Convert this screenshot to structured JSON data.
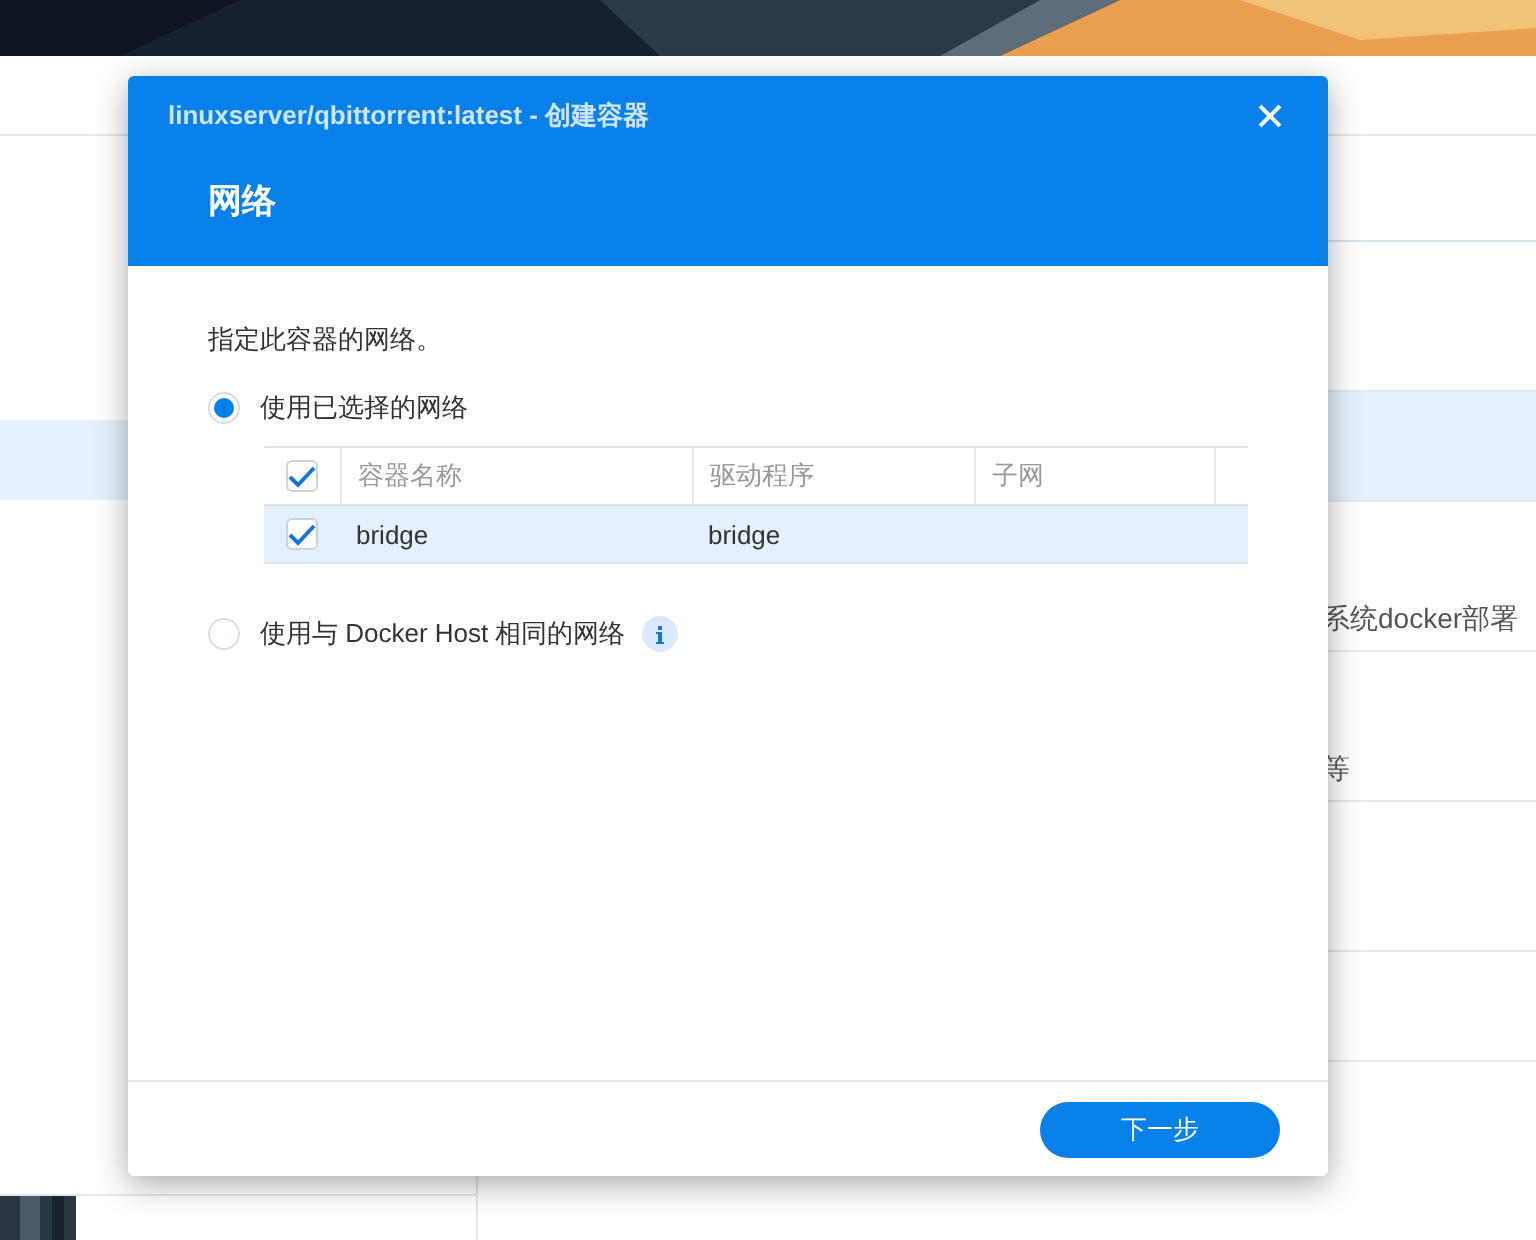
{
  "background": {
    "row_texts": [
      "系统docker部署",
      "等"
    ]
  },
  "dialog": {
    "title": "linuxserver/qbittorrent:latest - 创建容器",
    "heading": "网络",
    "description": "指定此容器的网络。",
    "options": [
      {
        "label": "使用已选择的网络",
        "selected": true,
        "info": false
      },
      {
        "label": "使用与 Docker Host 相同的网络",
        "selected": false,
        "info": true
      }
    ],
    "table": {
      "all_checked": true,
      "columns": [
        "容器名称",
        "驱动程序",
        "子网"
      ],
      "rows": [
        {
          "checked": true,
          "selected": true,
          "cells": [
            "bridge",
            "bridge",
            ""
          ]
        }
      ]
    },
    "buttons": [
      "下一步"
    ]
  }
}
